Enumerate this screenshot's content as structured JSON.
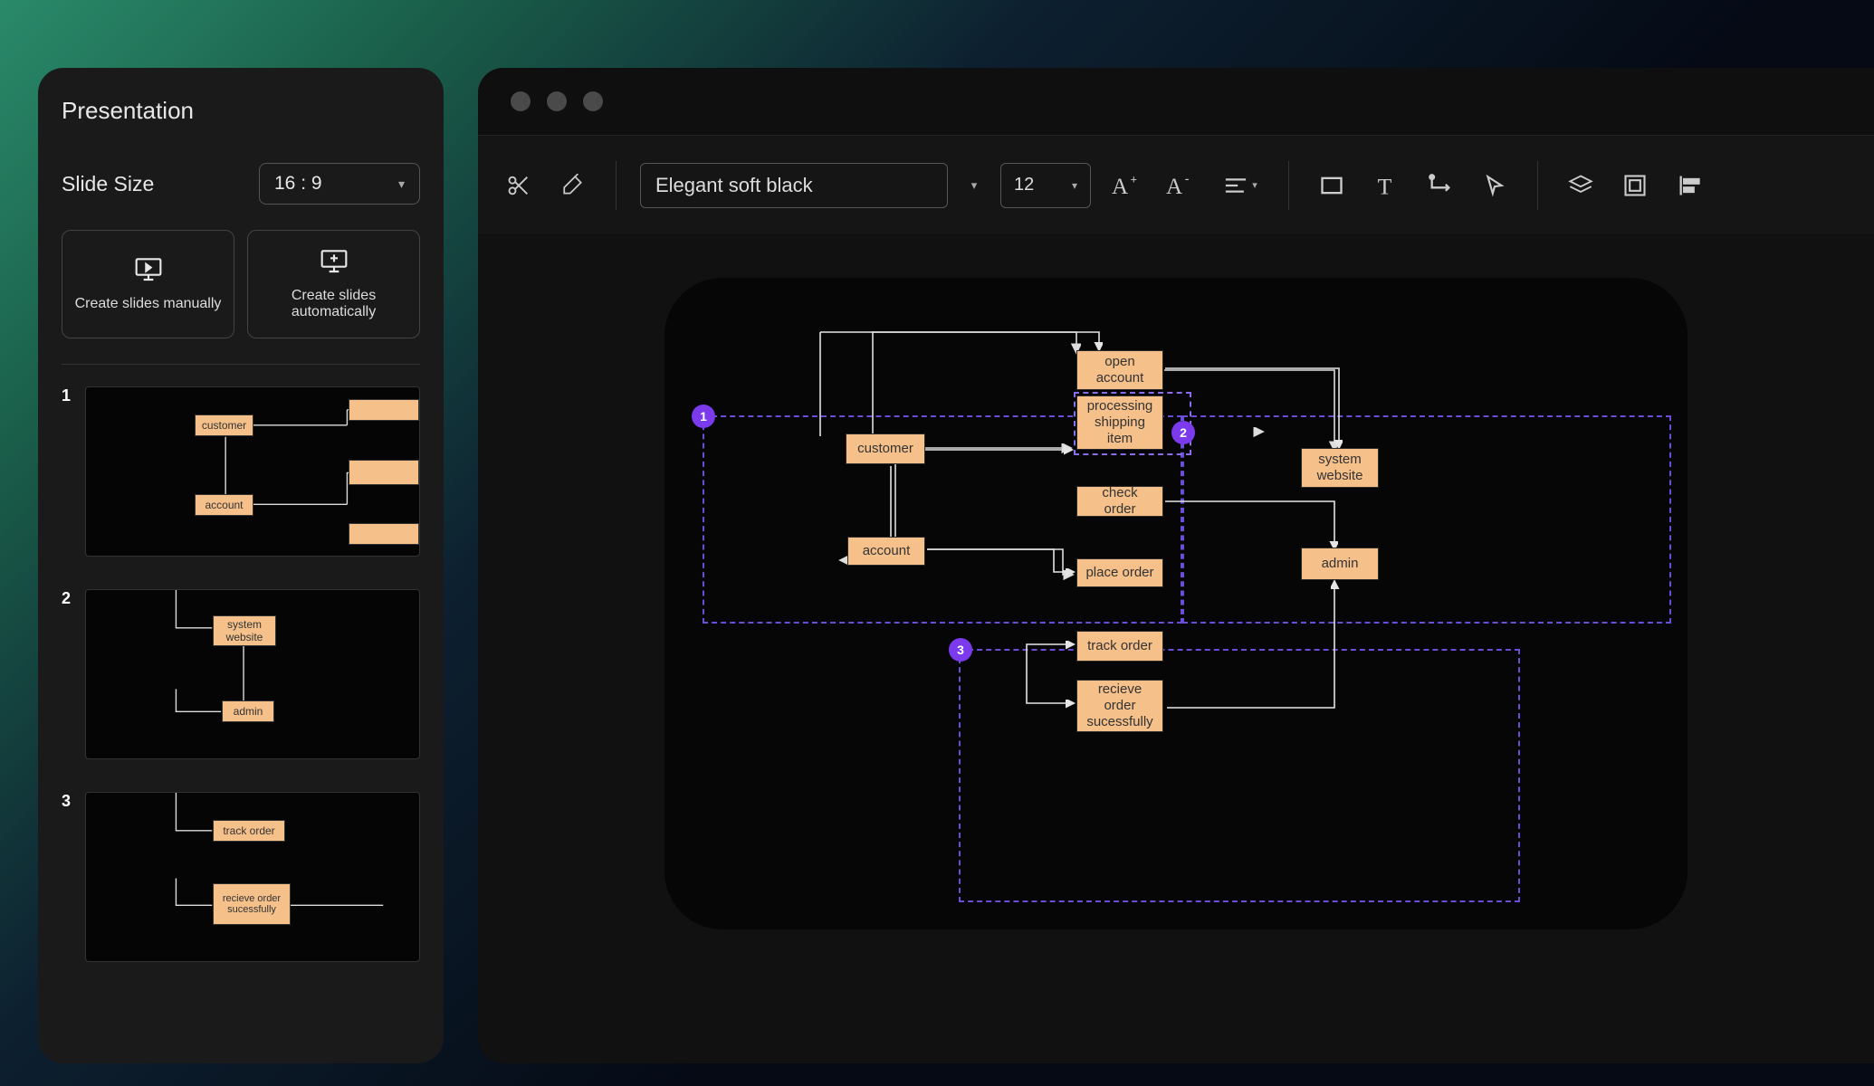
{
  "sidebar": {
    "title": "Presentation",
    "slide_size_label": "Slide Size",
    "slide_size_value": "16 : 9",
    "create_manual": "Create slides manually",
    "create_auto": "Create slides automatically",
    "thumbs": [
      {
        "num": "1",
        "boxes": [
          "customer",
          "account"
        ]
      },
      {
        "num": "2",
        "boxes": [
          "system website",
          "admin"
        ]
      },
      {
        "num": "3",
        "boxes": [
          "track order",
          "recieve order sucessfully"
        ]
      }
    ]
  },
  "toolbar": {
    "style_value": "Elegant soft black",
    "font_size": "12"
  },
  "canvas": {
    "markers": [
      "1",
      "2",
      "3"
    ],
    "nodes": {
      "open_account": "open\naccount",
      "customer": "customer",
      "processing": "processing\nshipping\nitem",
      "system_website": "system\nwebsite",
      "check_order": "check order",
      "account": "account",
      "place_order": "place order",
      "admin": "admin",
      "track_order": "track order",
      "recieve": "recieve\norder\nsucessfully"
    }
  }
}
